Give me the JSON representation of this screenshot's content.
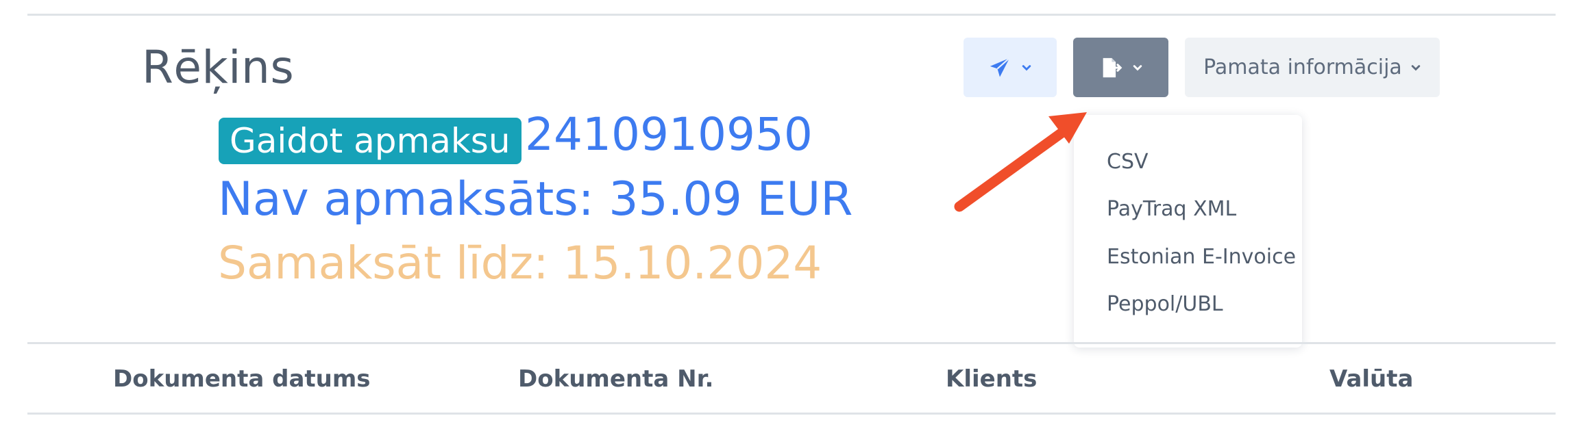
{
  "header": {
    "title": "Rēķins",
    "status_badge": "Gaidot apmaksu",
    "invoice_number": "2410910950",
    "unpaid": "Nav apmaksāts: 35.09 EUR",
    "due": "Samaksāt līdz: 15.10.2024"
  },
  "toolbar": {
    "info_label": "Pamata informācija"
  },
  "export_menu": {
    "items": [
      "CSV",
      "PayTraq XML",
      "Estonian E-Invoice",
      "Peppol/UBL"
    ]
  },
  "table": {
    "columns": [
      "Dokumenta datums",
      "Dokumenta Nr.",
      "Klients",
      "Valūta"
    ]
  },
  "colors": {
    "accent_blue": "#3d7bf0",
    "badge_teal": "#17a2b8",
    "due_orange": "#f4c78e",
    "annotation_arrow": "#f04e2a"
  },
  "icons": {
    "send": "paper-plane-icon",
    "export": "file-export-icon",
    "caret": "chevron-down-icon"
  }
}
